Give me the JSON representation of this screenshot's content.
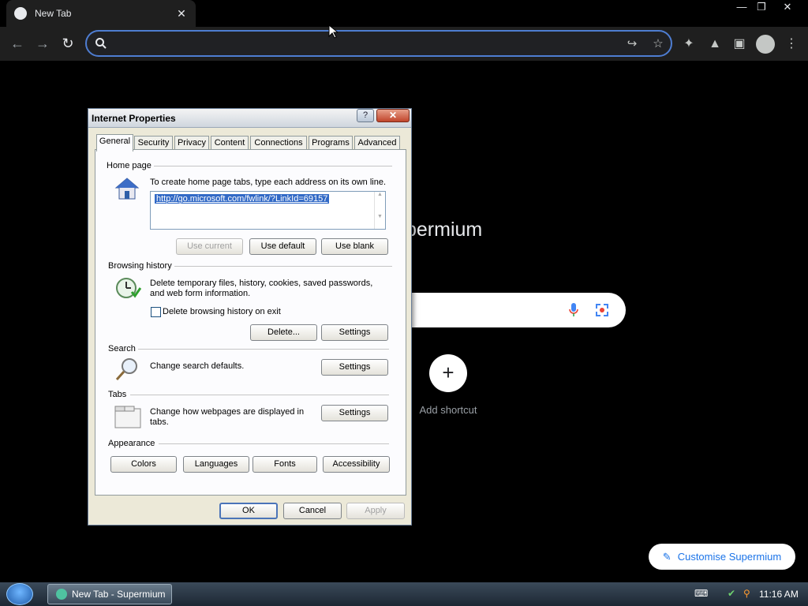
{
  "browser": {
    "tab_title": "New Tab",
    "omnibox_value": "",
    "brand_text": "permium",
    "add_shortcut_label": "Add shortcut",
    "customise_label": "Customise Supermium"
  },
  "dialog": {
    "title": "Internet Properties",
    "help_label": "?",
    "close_label": "✕",
    "tabs": [
      "General",
      "Security",
      "Privacy",
      "Content",
      "Connections",
      "Programs",
      "Advanced"
    ],
    "home_page": {
      "group_label": "Home page",
      "description": "To create home page tabs, type each address on its own line.",
      "url": "http://go.microsoft.com/fwlink/?LinkId=69157",
      "use_current": "Use current",
      "use_default": "Use default",
      "use_blank": "Use blank"
    },
    "browsing_history": {
      "group_label": "Browsing history",
      "description": "Delete temporary files, history, cookies, saved passwords, and web form information.",
      "checkbox_label": "Delete browsing history on exit",
      "checkbox_checked": false,
      "delete_label": "Delete...",
      "settings_label": "Settings"
    },
    "search": {
      "group_label": "Search",
      "description": "Change search defaults.",
      "settings_label": "Settings"
    },
    "tabs_section": {
      "group_label": "Tabs",
      "description": "Change how webpages are displayed in tabs.",
      "settings_label": "Settings"
    },
    "appearance": {
      "group_label": "Appearance",
      "colors": "Colors",
      "languages": "Languages",
      "fonts": "Fonts",
      "accessibility": "Accessibility"
    },
    "ok_label": "OK",
    "cancel_label": "Cancel",
    "apply_label": "Apply"
  },
  "taskbar": {
    "task_label": "New Tab - Supermium",
    "clock": "11:16 AM"
  },
  "colors": {
    "accent": "#4e7dd1",
    "link": "#1a73e8"
  }
}
